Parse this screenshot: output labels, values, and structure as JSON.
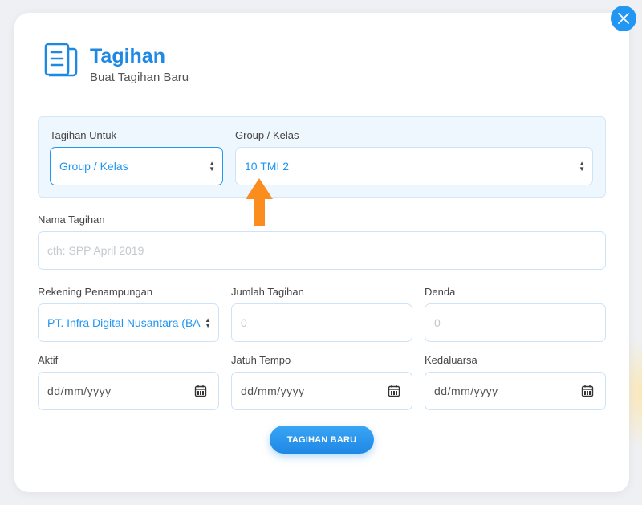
{
  "header": {
    "title": "Tagihan",
    "subtitle": "Buat Tagihan Baru",
    "icon": "invoice-book-icon"
  },
  "target": {
    "tagihan_untuk_label": "Tagihan Untuk",
    "tagihan_untuk_value": "Group / Kelas",
    "group_kelas_label": "Group / Kelas",
    "group_kelas_value": "10 TMI 2"
  },
  "nama_tagihan": {
    "label": "Nama Tagihan",
    "placeholder": "cth: SPP April 2019"
  },
  "rekening": {
    "label": "Rekening Penampungan",
    "value": "PT. Infra Digital Nusantara (BA"
  },
  "jumlah_tagihan": {
    "label": "Jumlah Tagihan",
    "placeholder": "0"
  },
  "denda": {
    "label": "Denda",
    "placeholder": "0"
  },
  "aktif": {
    "label": "Aktif",
    "placeholder": "dd/mm/yyyy"
  },
  "jatuh_tempo": {
    "label": "Jatuh Tempo",
    "placeholder": "dd/mm/yyyy"
  },
  "kedaluarsa": {
    "label": "Kedaluarsa",
    "placeholder": "dd/mm/yyyy"
  },
  "submit_label": "TAGIHAN BARU",
  "colors": {
    "accent": "#2196f3",
    "title": "#1e88e5",
    "arrow": "#fb8c1e"
  }
}
